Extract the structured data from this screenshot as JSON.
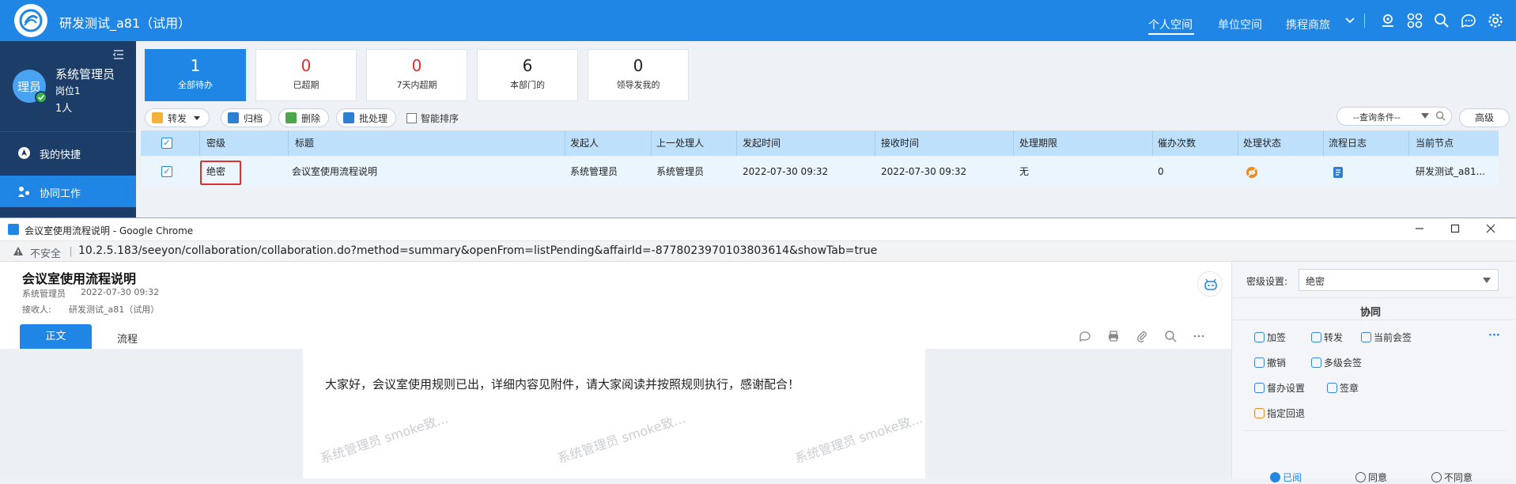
{
  "header": {
    "app_title": "研发测试_a81（试用）",
    "nav": [
      "个人空间",
      "单位空间",
      "携程商旅"
    ]
  },
  "sidebar": {
    "avatar_text": "理员",
    "user_name": "系统管理员",
    "post": "岗位1",
    "count": "1人",
    "items": [
      {
        "label": "我的快捷"
      },
      {
        "label": "协同工作"
      }
    ]
  },
  "stats": [
    {
      "num": "1",
      "label": "全部待办"
    },
    {
      "num": "0",
      "label": "已超期"
    },
    {
      "num": "0",
      "label": "7天内超期"
    },
    {
      "num": "6",
      "label": "本部门的"
    },
    {
      "num": "0",
      "label": "领导发我的"
    }
  ],
  "toolbar": {
    "forward": "转发",
    "archive": "归档",
    "delete": "删除",
    "batch": "批处理",
    "smart_sort": "智能排序",
    "query_placeholder": "--查询条件--",
    "advanced": "高级"
  },
  "table": {
    "headers": [
      "密级",
      "标题",
      "发起人",
      "上一处理人",
      "发起时间",
      "接收时间",
      "处理期限",
      "催办次数",
      "处理状态",
      "流程日志",
      "当前节点"
    ],
    "row": {
      "secret": "绝密",
      "title": "会议室使用流程说明",
      "sender": "系统管理员",
      "prev": "系统管理员",
      "start": "2022-07-30 09:32",
      "receive": "2022-07-30 09:32",
      "deadline": "无",
      "urge": "0",
      "node": "研发测试_a81..."
    }
  },
  "popup": {
    "window_title": "会议室使用流程说明 - Google Chrome",
    "insecure": "不安全",
    "url": "10.2.5.183/seeyon/collaboration/collaboration.do?method=summary&openFrom=listPending&affairId=-8778023970103803614&showTab=true",
    "doc_title": "会议室使用流程说明",
    "doc_sender": "系统管理员",
    "doc_time": "2022-07-30 09:32",
    "receiver_label": "接收人:",
    "receiver": "研发测试_a81（试用）",
    "tab_body": "正文",
    "tab_flow": "流程",
    "content": "大家好，会议室使用规则已出，详细内容见附件，请大家阅读并按照规则执行，感谢配合！",
    "watermark": "系统管理员  smoke致..."
  },
  "right_panel": {
    "secret_label": "密级设置:",
    "secret_value": "绝密",
    "section": "协同",
    "actions": [
      "加签",
      "转发",
      "当前会签",
      "撤销",
      "多级会签",
      "督办设置",
      "签章",
      "指定回退"
    ],
    "bottom": [
      "已阅",
      "同意",
      "不同意"
    ]
  },
  "colors": {
    "primary": "#1f86e6",
    "sidebar": "#1b3d68",
    "danger": "#e22d2d"
  }
}
